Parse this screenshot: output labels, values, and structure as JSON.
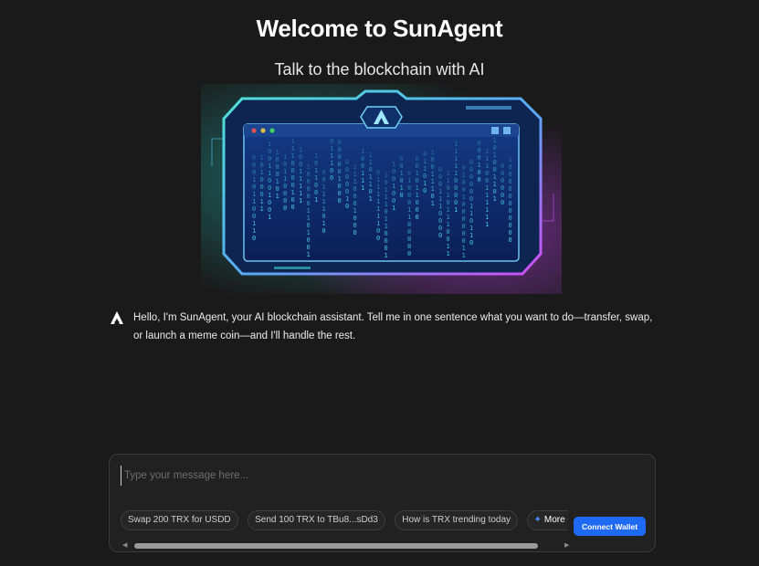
{
  "header": {
    "title": "Welcome to SunAgent",
    "subtitle": "Talk to the blockchain with AI"
  },
  "hero": {
    "icon": "sunagent-logo-icon",
    "matrix_chars": "01",
    "colors": {
      "frame": "#5ab8f0",
      "glow_left": "#1fd0c8",
      "glow_right": "#c040f0",
      "screen": "#0f2a6a",
      "rain": "#48d8e8"
    }
  },
  "assistant": {
    "icon": "sunagent-logo-icon",
    "message": "Hello, I'm SunAgent, your AI blockchain assistant. Tell me in one sentence what you want to do—transfer, swap, or launch a meme coin—and I'll handle the rest."
  },
  "composer": {
    "placeholder": "Type your message here...",
    "value": "",
    "suggestions": [
      "Swap 200 TRX for USDD",
      "Send 100 TRX to TBu8...sDd3",
      "How is TRX trending today"
    ],
    "more_label": "More Commands",
    "more_icon": "sparkle-icon",
    "connect_label": "Connect Wallet",
    "scrollbar": {
      "left_icon": "scroll-left-icon",
      "right_icon": "scroll-right-icon"
    }
  },
  "colors": {
    "background": "#1a1a1a",
    "accent": "#1f6af5"
  }
}
